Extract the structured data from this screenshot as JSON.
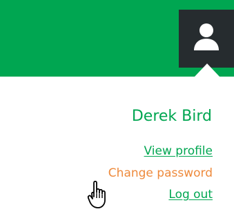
{
  "header": {
    "user_icon": "user-icon"
  },
  "user_menu": {
    "name": "Derek Bird",
    "links": [
      {
        "label": "View profile",
        "state": "normal"
      },
      {
        "label": "Change password",
        "state": "hover"
      },
      {
        "label": "Log out",
        "state": "normal"
      }
    ]
  },
  "cursor": {
    "icon": "hand-pointer-icon"
  },
  "colors": {
    "brand_green": "#00a651",
    "dark_toggle": "#262c2f",
    "hover_orange": "#ee8a3c",
    "background": "#ffffff"
  }
}
